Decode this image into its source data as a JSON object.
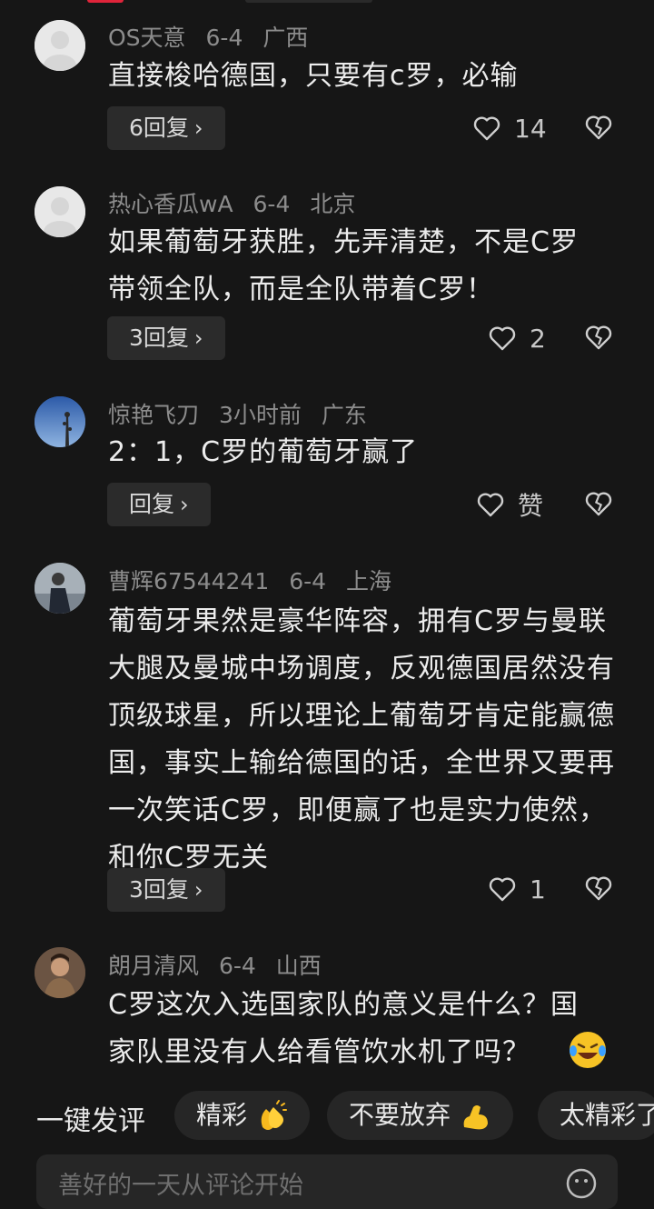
{
  "comments": [
    {
      "user": "OS天意",
      "date": "6-4",
      "location": "广西",
      "text": "直接梭哈德国，只要有c罗，必输",
      "replies": "6回复",
      "likes": "14"
    },
    {
      "user": "热心香瓜wA",
      "date": "6-4",
      "location": "北京",
      "text": "如果葡萄牙获胜，先弄清楚，不是C罗带领全队，而是全队带着C罗！",
      "replies": "3回复",
      "likes": "2"
    },
    {
      "user": "惊艳飞刀",
      "date": "3小时前",
      "location": "广东",
      "text": "2：1，C罗的葡萄牙赢了",
      "replies": "回复",
      "likes": "赞"
    },
    {
      "user": "曹辉67544241",
      "date": "6-4",
      "location": "上海",
      "text": "葡萄牙果然是豪华阵容，拥有C罗与曼联大腿及曼城中场调度，反观德国居然没有顶级球星，所以理论上葡萄牙肯定能赢德国，事实上输给德国的话，全世界又要再一次笑话C罗，即便赢了也是实力使然，和你C罗无关",
      "replies": "3回复",
      "likes": "1"
    },
    {
      "user": "朗月清风",
      "date": "6-4",
      "location": "山西",
      "text": "C罗这次入选国家队的意义是什么？国家队里没有人给看管饮水机了吗？"
    }
  ],
  "quick_reply": {
    "label": "一键发评",
    "chips": [
      "精彩",
      "不要放弃",
      "太精彩了"
    ]
  },
  "input": {
    "placeholder": "善好的一天从评论开始"
  },
  "icons": {
    "like": "heart-outline-icon",
    "dislike": "broken-heart-icon",
    "chevron": "chevron-right-icon",
    "emoji": "smile-icon"
  },
  "colors": {
    "background": "#161616",
    "chip": "#262626",
    "reply_button": "#2b2b2b"
  }
}
